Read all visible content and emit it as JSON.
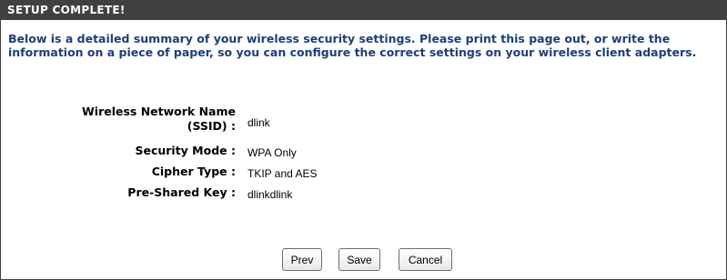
{
  "header": {
    "title": "SETUP COMPLETE!"
  },
  "intro": "Below is a detailed summary of your wireless security settings. Please print this page out, or write the information on a piece of paper, so you can configure the correct settings on your wireless client adapters.",
  "fields": {
    "ssid": {
      "label_line1": "Wireless Network Name",
      "label_line2": "(SSID) :",
      "value": "dlink"
    },
    "security_mode": {
      "label": "Security Mode :",
      "value": "WPA Only"
    },
    "cipher_type": {
      "label": "Cipher Type :",
      "value": "TKIP and AES"
    },
    "psk": {
      "label": "Pre-Shared Key :",
      "value": "dlinkdlink"
    }
  },
  "buttons": {
    "prev": "Prev",
    "save": "Save",
    "cancel": "Cancel"
  }
}
